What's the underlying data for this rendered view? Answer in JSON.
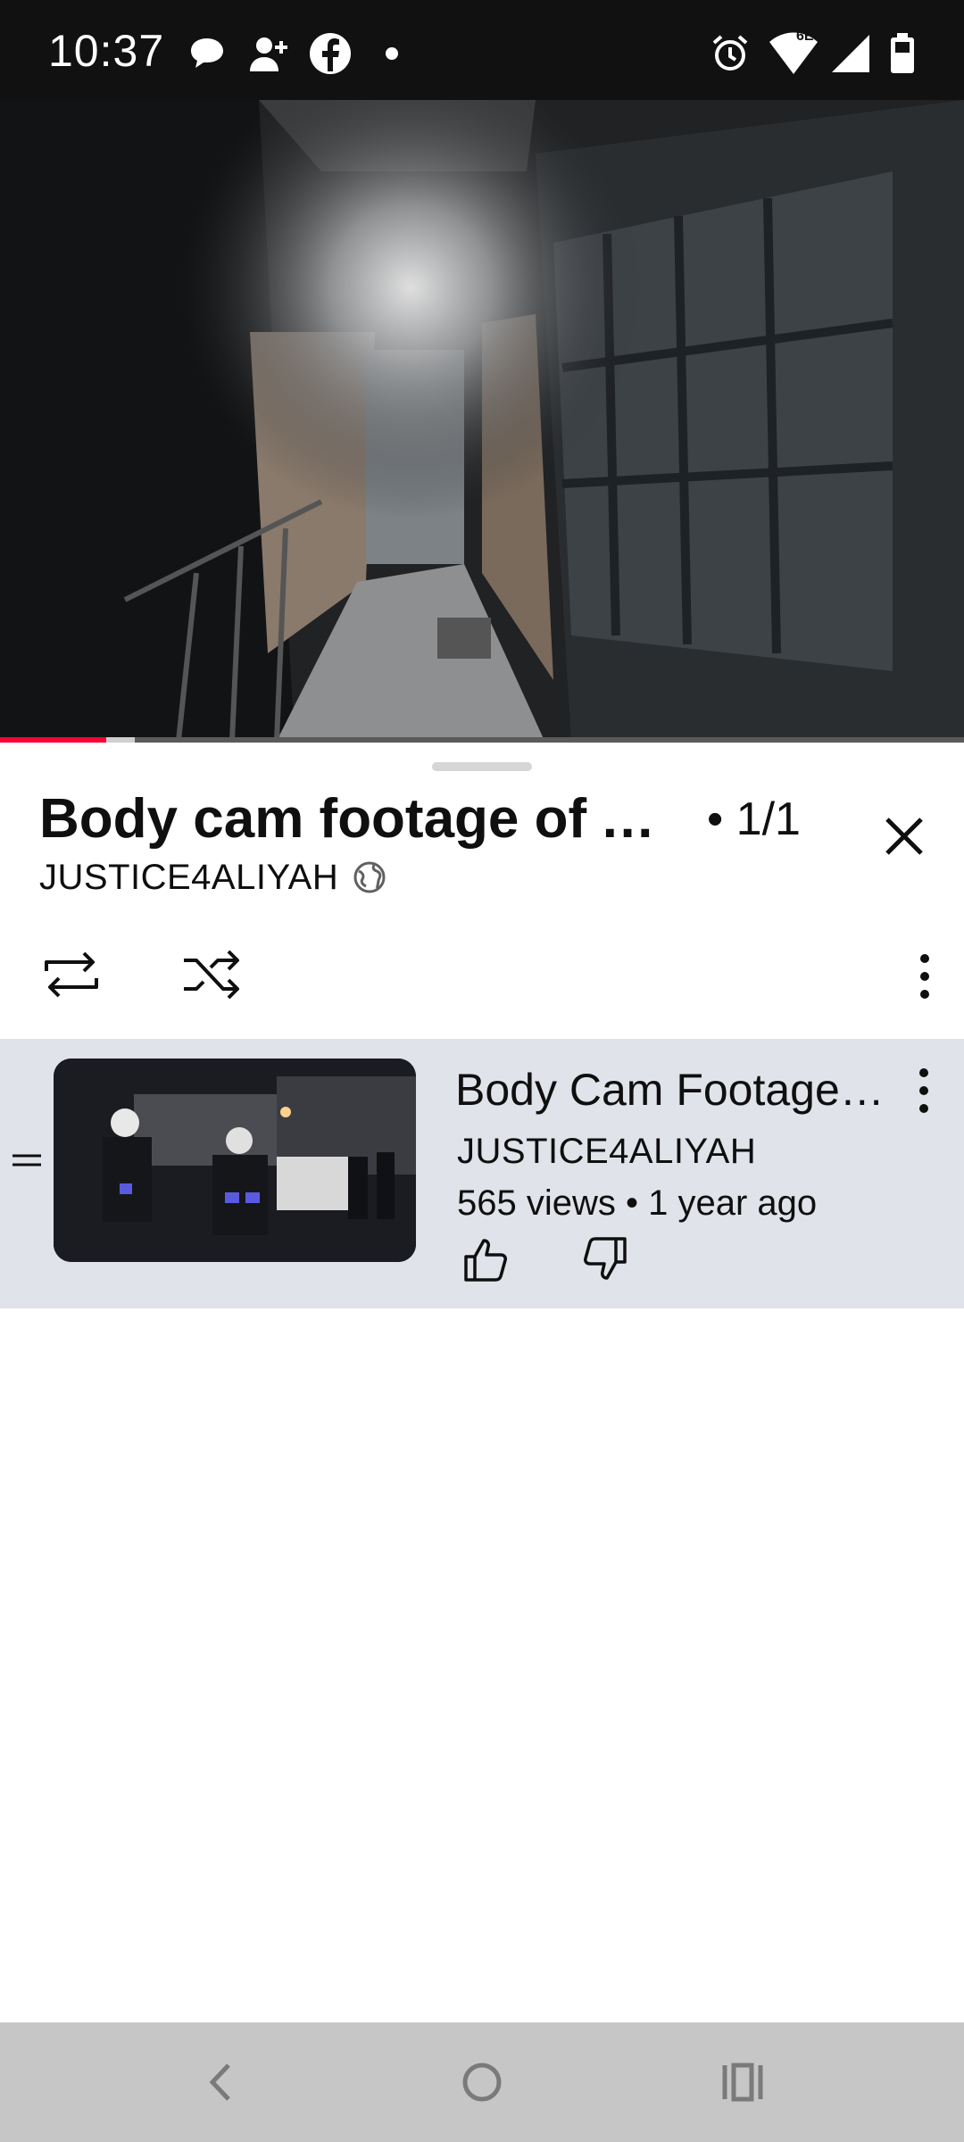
{
  "status_bar": {
    "time": "10:37",
    "network_badge": "6E",
    "icons": [
      "chat-bubble-icon",
      "person-add-icon",
      "facebook-icon",
      "dot-icon",
      "alarm-icon",
      "wifi-icon",
      "signal-icon",
      "battery-icon"
    ]
  },
  "video": {
    "progress_fraction": 0.11,
    "buffered_fraction": 0.14
  },
  "playlist": {
    "title": "Body cam footage of Aliyah",
    "position": "• 1/1",
    "channel": "JUSTICE4ALIYAH",
    "visibility_icon": "globe-icon",
    "controls": [
      "loop-icon",
      "shuffle-icon",
      "more-vert-icon"
    ]
  },
  "items": [
    {
      "title": "Body Cam Footage of Aliyah",
      "channel": "JUSTICE4ALIYAH",
      "meta": "565 views • 1 year ago",
      "actions": [
        "like-icon",
        "dislike-icon"
      ]
    }
  ],
  "colors": {
    "accent_red": "#ff0033",
    "selected_item_bg": "#e1e3ea",
    "nav_bar_bg": "#c6c6c6"
  }
}
